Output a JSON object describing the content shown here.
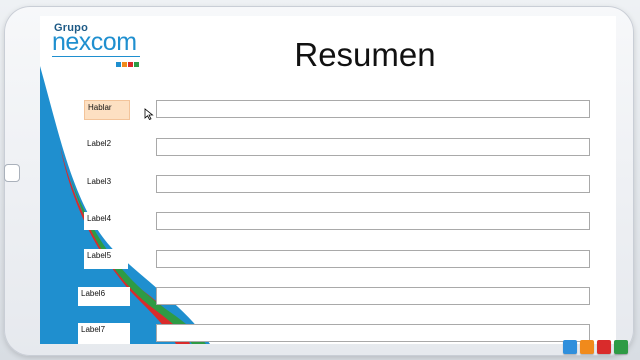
{
  "logo": {
    "grupo": "Grupo",
    "name": "nexcom",
    "squares": [
      "#1f8fcf",
      "#f08a1c",
      "#d92b2b",
      "#2e9b45"
    ]
  },
  "title": "Resumen",
  "fields": [
    {
      "label": "Hablar",
      "value": ""
    },
    {
      "label": "Label2",
      "value": ""
    },
    {
      "label": "Label3",
      "value": ""
    },
    {
      "label": "Label4",
      "value": ""
    },
    {
      "label": "Label5",
      "value": ""
    },
    {
      "label": "Label6",
      "value": ""
    },
    {
      "label": "Label7",
      "value": ""
    }
  ],
  "tiles": [
    "#2f8fdc",
    "#f08a1c",
    "#d92b2b",
    "#2e9b45"
  ]
}
